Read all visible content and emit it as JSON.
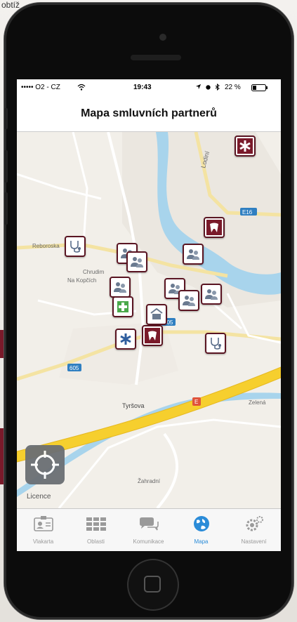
{
  "background": {
    "fragment_text": "obtíž"
  },
  "status_bar": {
    "carrier": "••••• O2 - CZ",
    "time": "19:43",
    "battery": "22 %"
  },
  "nav": {
    "title": "Mapa smluvních partnerů"
  },
  "map": {
    "licence": "Licence",
    "labels": {
      "lodni": "Lodiní",
      "rejzhorska": "Reboroska",
      "na_kopcich": "Na Kopčích",
      "chrudim": "Chrudim",
      "tyrsova": "Tyršova",
      "zelena": "Zelená",
      "zahradni": "Žahradní",
      "road_605": "605",
      "road_606": "605",
      "road_e": "E",
      "road_116": "E16"
    },
    "markers": [
      "doctor",
      "doctor",
      "doctor",
      "doctor",
      "doctor",
      "doctor",
      "doctor",
      "dental",
      "dental",
      "stethoscope",
      "stethoscope",
      "pharmacy",
      "ambulance",
      "emergency",
      "gp-office"
    ]
  },
  "tabbar": {
    "items": [
      {
        "label": "Vlakarta",
        "icon": "id-card-icon"
      },
      {
        "label": "Oblasti",
        "icon": "grid-icon"
      },
      {
        "label": "Komunikace",
        "icon": "chat-icon"
      },
      {
        "label": "Mapa",
        "icon": "globe-icon"
      },
      {
        "label": "Nastavení",
        "icon": "gears-icon"
      }
    ],
    "active_index": 3,
    "accent": "#2b8cd8",
    "inactive": "#9a9a9a"
  }
}
